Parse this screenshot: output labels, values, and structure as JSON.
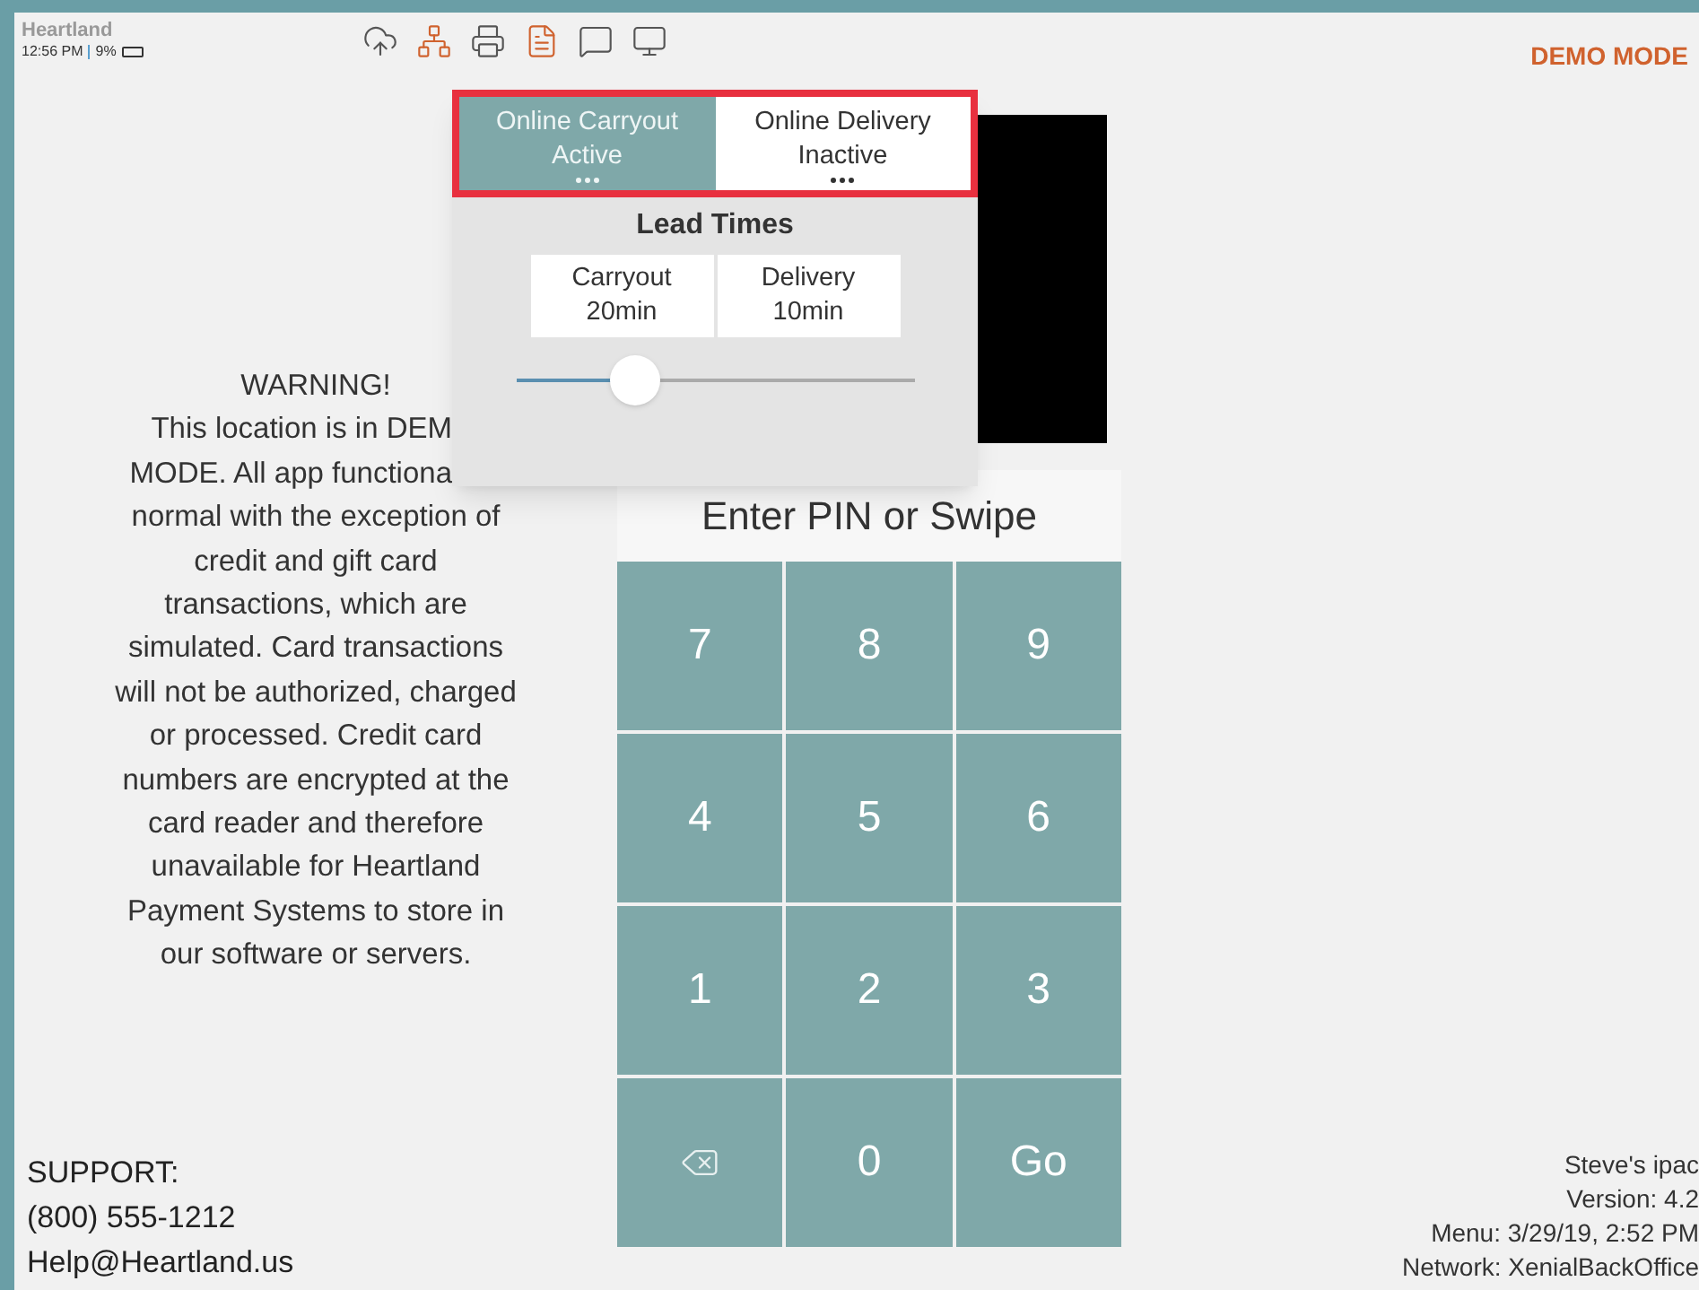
{
  "status": {
    "brand": "Heartland",
    "time": "12:56 PM",
    "battery": "9%"
  },
  "toolbar": [
    {
      "kind": "cloud",
      "color": "#555555"
    },
    {
      "kind": "network",
      "color": "#d0622e"
    },
    {
      "kind": "printer",
      "color": "#555555"
    },
    {
      "kind": "document",
      "color": "#d0622e"
    },
    {
      "kind": "chat",
      "color": "#555555"
    },
    {
      "kind": "monitor",
      "color": "#555555"
    }
  ],
  "mode": "DEMO MODE",
  "popup": {
    "tabs": [
      {
        "label": "Online Carryout",
        "status": "Active",
        "selected": true
      },
      {
        "label": "Online Delivery",
        "status": "Inactive",
        "selected": false
      }
    ],
    "title": "Lead Times",
    "times": [
      {
        "label": "Carryout",
        "value": "20min"
      },
      {
        "label": "Delivery",
        "value": "10min"
      }
    ],
    "slider": {
      "level": 0.3
    }
  },
  "warning": [
    {
      "text": "WARNING!",
      "cut": false
    },
    {
      "text": "This location is in DEM",
      "cut": true
    },
    {
      "text": "MODE. All app functiona",
      "cut": true
    },
    {
      "text": "normal with the exception of",
      "cut": false
    },
    {
      "text": "credit and gift card",
      "cut": false
    },
    {
      "text": "transactions, which are",
      "cut": false
    },
    {
      "text": "simulated. Card transactions",
      "cut": false
    },
    {
      "text": "will not be authorized, charged",
      "cut": false
    },
    {
      "text": "or processed. Credit card",
      "cut": false
    },
    {
      "text": "numbers are encrypted at the",
      "cut": false
    },
    {
      "text": "card reader and therefore",
      "cut": false
    },
    {
      "text": "unavailable for Heartland",
      "cut": false
    },
    {
      "text": "Payment Systems to store in",
      "cut": false
    },
    {
      "text": "our software or servers.",
      "cut": false
    }
  ],
  "support": [
    "SUPPORT:",
    "(800) 555-1212",
    "Help@Heartland.us"
  ],
  "pin": {
    "prompt": "Enter PIN or Swipe",
    "keys": [
      {
        "kind": "digit",
        "label": "7"
      },
      {
        "kind": "digit",
        "label": "8"
      },
      {
        "kind": "digit",
        "label": "9"
      },
      {
        "kind": "digit",
        "label": "4"
      },
      {
        "kind": "digit",
        "label": "5"
      },
      {
        "kind": "digit",
        "label": "6"
      },
      {
        "kind": "digit",
        "label": "1"
      },
      {
        "kind": "digit",
        "label": "2"
      },
      {
        "kind": "digit",
        "label": "3"
      },
      {
        "kind": "backspace"
      },
      {
        "kind": "digit",
        "label": "0"
      },
      {
        "kind": "go",
        "label": "Go"
      }
    ]
  },
  "device": [
    "Steve's ipac",
    "Version: 4.2",
    "Menu: 3/29/19, 2:52 PM",
    "Network: XenialBackOffice"
  ]
}
